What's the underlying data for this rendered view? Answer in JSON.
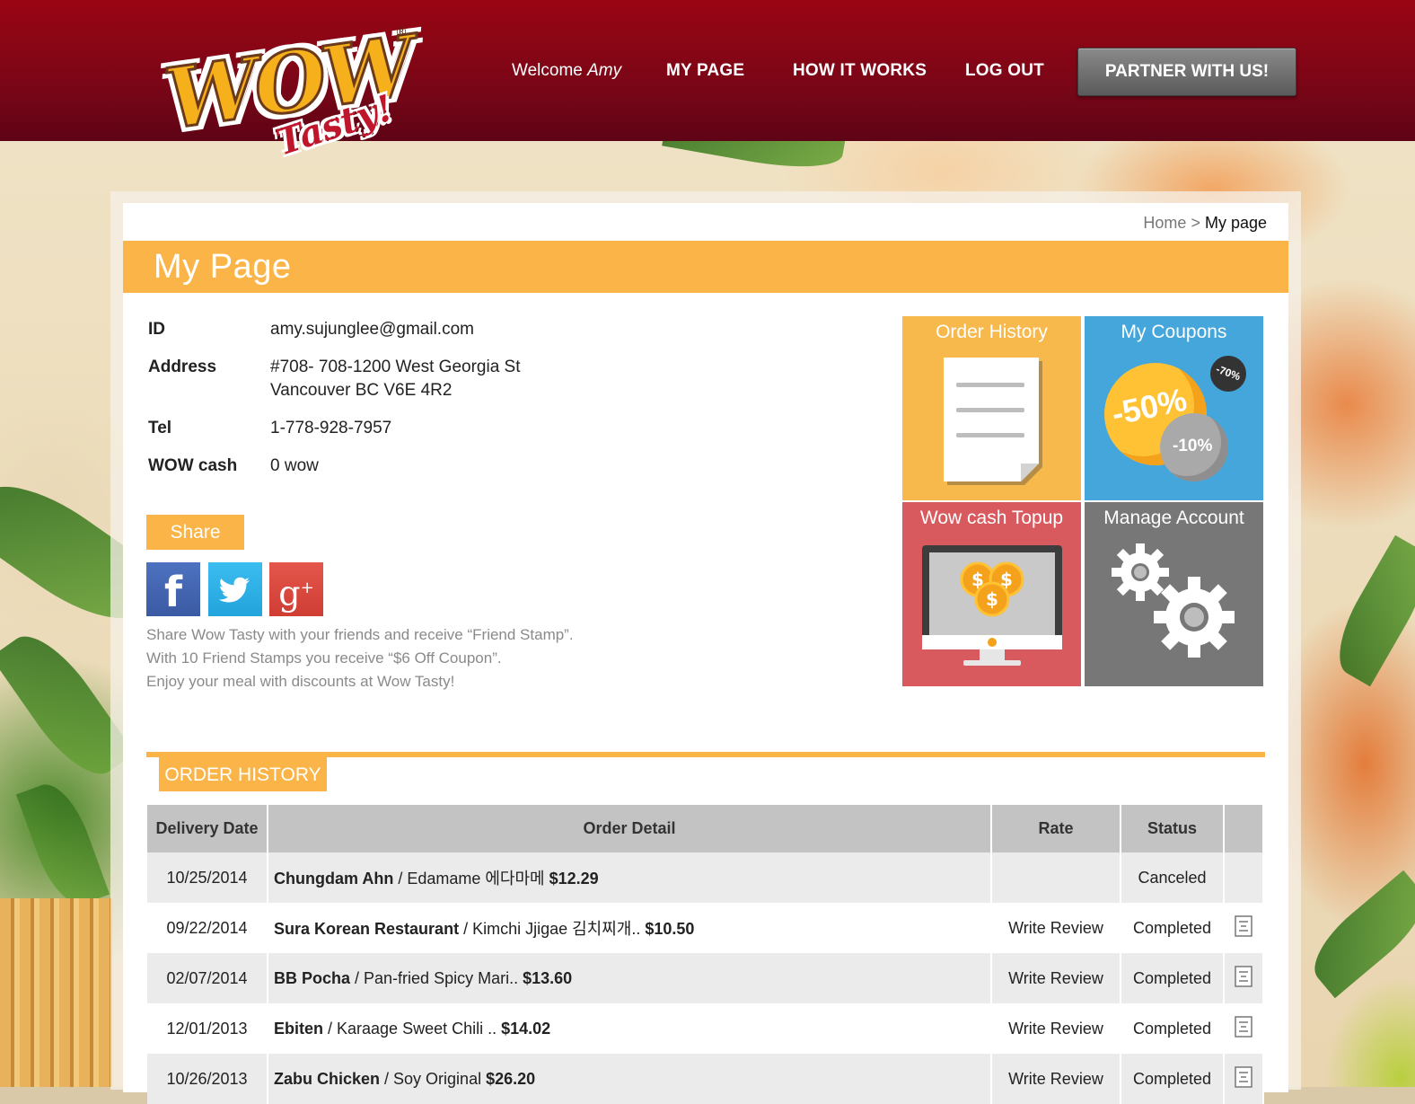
{
  "header": {
    "logo_text": "WOW",
    "logo_subtext": "Tasty!",
    "logo_mark": "®",
    "welcome_prefix": "Welcome",
    "welcome_name": "Amy",
    "nav": {
      "my_page": "MY PAGE",
      "how_it_works": "HOW IT WORKS",
      "log_out": "LOG OUT"
    },
    "partner_button": "PARTNER WITH US!"
  },
  "breadcrumb": {
    "home": "Home",
    "separator": " > ",
    "current": "My page"
  },
  "page_title": "My Page",
  "profile": {
    "id_label": "ID",
    "id_value": "amy.sujunglee@gmail.com",
    "address_label": "Address",
    "address_line1": "#708- 708-1200 West Georgia St",
    "address_line2": "Vancouver BC V6E 4R2",
    "tel_label": "Tel",
    "tel_value": "1-778-928-7957",
    "wowcash_label": "WOW cash",
    "wowcash_value": "0 wow"
  },
  "share": {
    "button": "Share",
    "social": [
      "facebook-icon",
      "twitter-icon",
      "google-plus-icon"
    ],
    "text_line1": "Share Wow Tasty with your friends and receive “Friend Stamp”.",
    "text_line2": "With 10 Friend Stamps you receive “$6 Off Coupon”.",
    "text_line3": "Enjoy your meal with discounts at Wow Tasty!"
  },
  "tiles": {
    "order_history": "Order History",
    "my_coupons": "My Coupons",
    "coupon_big": "-50%",
    "coupon_small": "-10%",
    "coupon_tiny": "-70%",
    "wow_cash_topup": "Wow cash Topup",
    "manage_account": "Manage Account"
  },
  "colors": {
    "header_red": "#8a0515",
    "accent_orange": "#fbb447",
    "tile_blue": "#45a6dc",
    "tile_red": "#d95a5e",
    "tile_grey": "#777777"
  },
  "order_history": {
    "heading": "ORDER HISTORY",
    "columns": [
      "Delivery Date",
      "Order Detail",
      "Rate",
      "Status",
      ""
    ],
    "rows": [
      {
        "date": "10/25/2014",
        "restaurant": "Chungdam Ahn",
        "item": " / Edamame 에다마메 ",
        "price": "$12.29",
        "rate": "",
        "status": "Canceled",
        "has_icon": false
      },
      {
        "date": "09/22/2014",
        "restaurant": "Sura Korean Restaurant",
        "item": " / Kimchi Jjigae 김치찌개.. ",
        "price": "$10.50",
        "rate": "Write Review",
        "status": "Completed",
        "has_icon": true
      },
      {
        "date": "02/07/2014",
        "restaurant": "BB Pocha",
        "item": " / Pan-fried Spicy Mari.. ",
        "price": "$13.60",
        "rate": "Write Review",
        "status": "Completed",
        "has_icon": true
      },
      {
        "date": "12/01/2013",
        "restaurant": "Ebiten",
        "item": " / Karaage Sweet Chili .. ",
        "price": "$14.02",
        "rate": "Write Review",
        "status": "Completed",
        "has_icon": true
      },
      {
        "date": "10/26/2013",
        "restaurant": "Zabu Chicken",
        "item": " / Soy Original ",
        "price": "$26.20",
        "rate": "Write Review",
        "status": "Completed",
        "has_icon": true
      }
    ]
  }
}
